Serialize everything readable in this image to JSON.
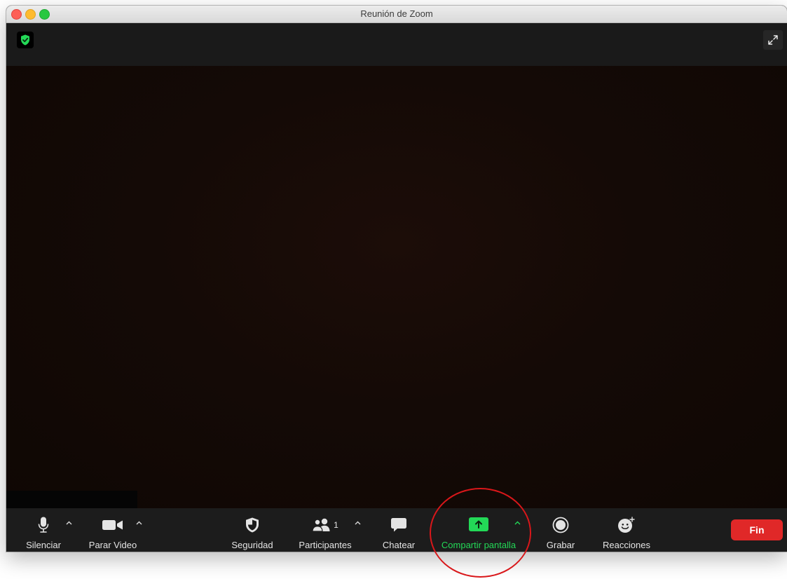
{
  "window": {
    "title": "Reunión de Zoom"
  },
  "toolbar": {
    "mute_label": "Silenciar",
    "video_label": "Parar Video",
    "security_label": "Seguridad",
    "participants_label": "Participantes",
    "participants_count": "1",
    "chat_label": "Chatear",
    "share_label": "Compartir pantalla",
    "record_label": "Grabar",
    "reactions_label": "Reacciones",
    "end_label": "Fin"
  },
  "icons": {
    "encryption": "shield-check-icon",
    "expand": "expand-icon",
    "mute": "microphone-icon",
    "video": "video-camera-icon",
    "security": "shield-icon",
    "participants": "people-icon",
    "chat": "chat-bubble-icon",
    "share": "share-screen-icon",
    "record": "record-icon",
    "reactions": "smiley-plus-icon",
    "caret": "caret-up-icon"
  },
  "colors": {
    "share_accent": "#23d957",
    "end_button": "#e02828",
    "encryption_shield": "#23d957",
    "annotation_circle": "#d9171a"
  }
}
